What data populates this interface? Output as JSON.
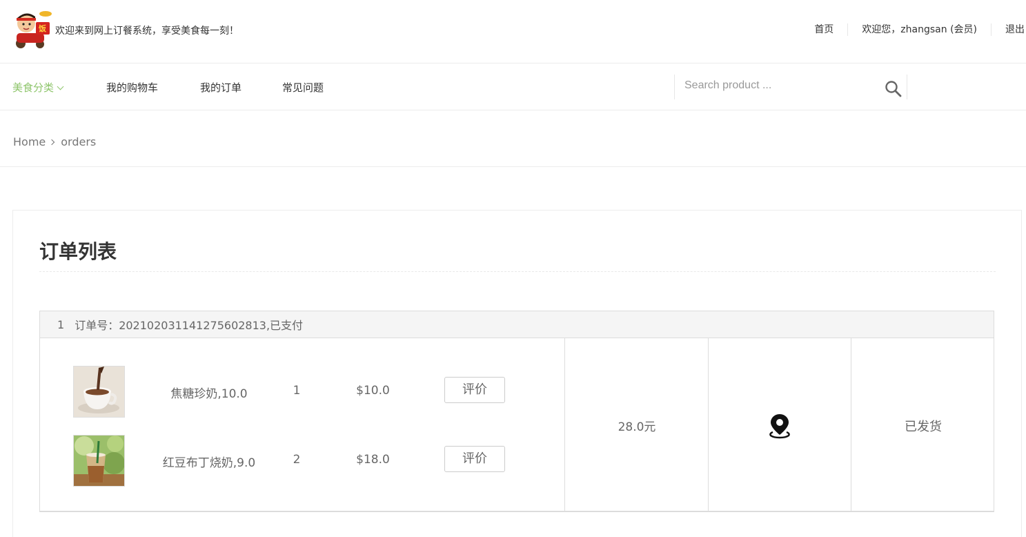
{
  "header": {
    "welcome": "欢迎来到网上订餐系统，享受美食每一刻！",
    "links": [
      "首页",
      "欢迎您，zhangsan (会员)",
      "退出"
    ]
  },
  "nav": {
    "items": [
      "美食分类",
      "我的购物车",
      "我的订单",
      "常见问题"
    ],
    "active_color": "#8ec56b"
  },
  "search": {
    "placeholder": "Search product ..."
  },
  "breadcrumb": {
    "home": "Home",
    "current": "orders"
  },
  "main": {
    "title": "订单列表",
    "order": {
      "index": "1",
      "header": "订单号：20210203114127560281­3,已支付",
      "items": [
        {
          "name": "焦糖珍奶,10.0",
          "qty": "1",
          "price": "$10.0",
          "review": "评价",
          "image": "coffee-cup-image"
        },
        {
          "name": "红豆布丁烧奶,9.0",
          "qty": "2",
          "price": "$18.0",
          "review": "评价",
          "image": "iced-drink-image"
        }
      ],
      "total": "28.0元",
      "location_icon": "map-pin-icon",
      "status": "已发货"
    }
  }
}
